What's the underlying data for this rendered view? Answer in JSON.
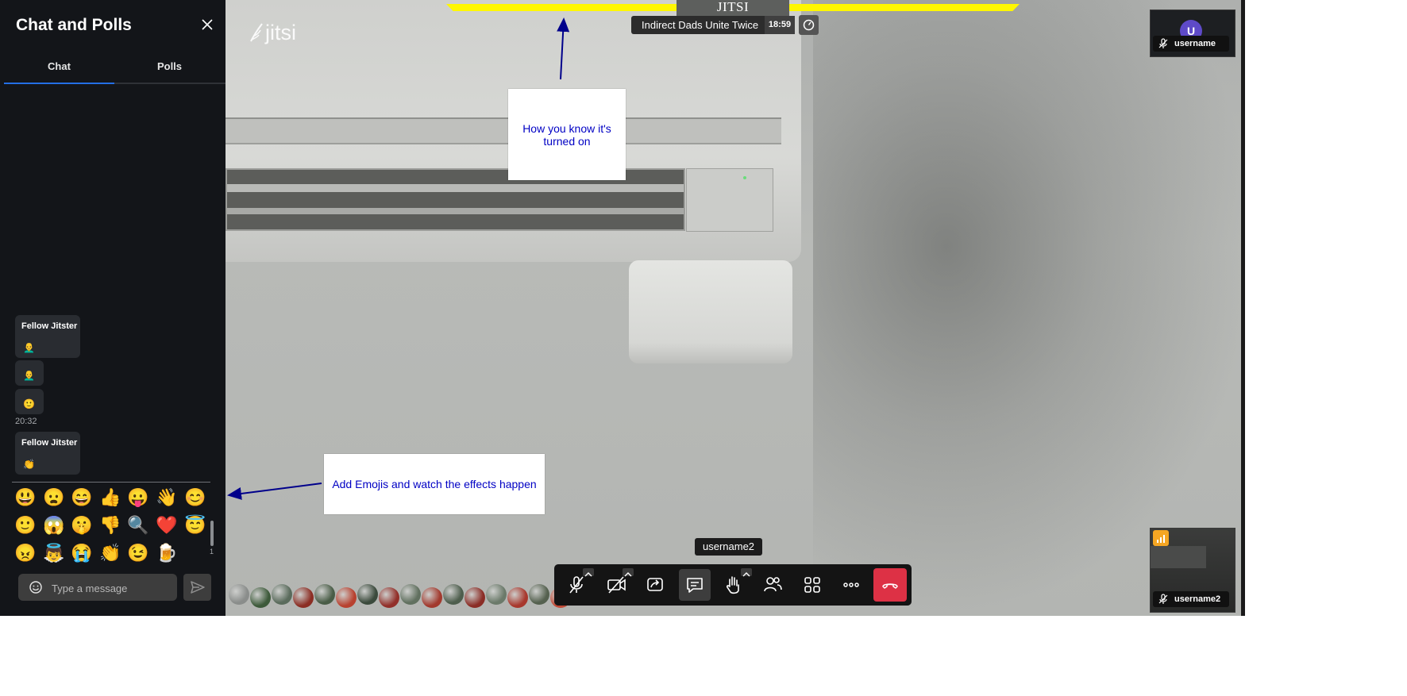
{
  "sidebar": {
    "title": "Chat and Polls",
    "tabs": [
      {
        "label": "Chat"
      },
      {
        "label": "Polls"
      }
    ],
    "messages": [
      {
        "sender": "Fellow Jitster",
        "body": "👨‍🦲"
      },
      {
        "body": "👨‍🦲"
      },
      {
        "body": "🙂"
      },
      {
        "sender": "Fellow Jitster",
        "body": "👏"
      }
    ],
    "timestamp": "20:32",
    "emojis": [
      "😃",
      "😦",
      "😄",
      "👍",
      "😛",
      "👋",
      "😊",
      "🙂",
      "😱",
      "🤫",
      "👎",
      "🔍",
      "❤️",
      "😇",
      "😠",
      "👼",
      "😭",
      "👏",
      "😉",
      "🍺"
    ],
    "scroll_indicator": "1",
    "input_placeholder": "Type a message"
  },
  "stage": {
    "logo": "jitsi",
    "banner": "JITSI ENHANCED",
    "meeting_name": "Indirect Dads Unite Twice",
    "meeting_time": "18:59",
    "speaker_name": "username2",
    "participants": [
      {
        "name": "username",
        "avatar": "U"
      },
      {
        "name": "username2"
      }
    ]
  },
  "annotations": {
    "top": "How you know it's turned on",
    "bottom": "Add Emojis and watch the effects happen"
  },
  "colors": {
    "accent": "#246fe5",
    "banner": "#fff700",
    "hangup": "#dd3145",
    "avatar": "#5e4ac8",
    "annotation_text": "#0000c4",
    "arrow": "#00008b"
  }
}
